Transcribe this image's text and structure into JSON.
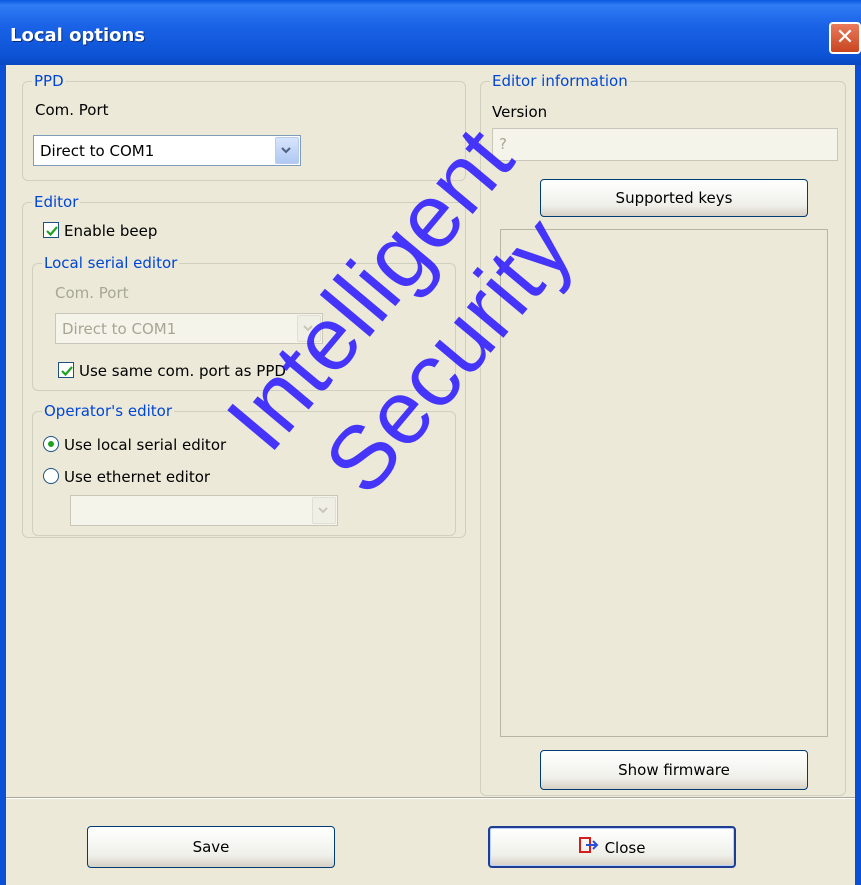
{
  "window": {
    "title": "Local options",
    "close_glyph": "✕"
  },
  "ppd": {
    "legend": "PPD",
    "com_port_label": "Com. Port",
    "com_port_value": "Direct to COM1"
  },
  "editor": {
    "legend": "Editor",
    "enable_beep_label": "Enable beep",
    "enable_beep_checked": true,
    "local_serial": {
      "legend": "Local serial editor",
      "com_port_label": "Com. Port",
      "com_port_value": "Direct to COM1",
      "same_port_label": "Use same com. port as PPD",
      "same_port_checked": true
    },
    "operators": {
      "legend": "Operator's editor",
      "local_serial_label": "Use local serial editor",
      "ethernet_label": "Use ethernet editor",
      "selected": "local_serial",
      "ethernet_value": ""
    }
  },
  "editor_info": {
    "legend": "Editor information",
    "version_label": "Version",
    "version_value": "?",
    "supported_keys_label": "Supported keys",
    "show_firmware_label": "Show firmware"
  },
  "footer": {
    "save_label": "Save",
    "close_label": "Close"
  },
  "watermark": "Intelligent Security",
  "colors": {
    "accent": "#0046d5",
    "titlebar": "#0a5adf",
    "check": "#21a121"
  }
}
